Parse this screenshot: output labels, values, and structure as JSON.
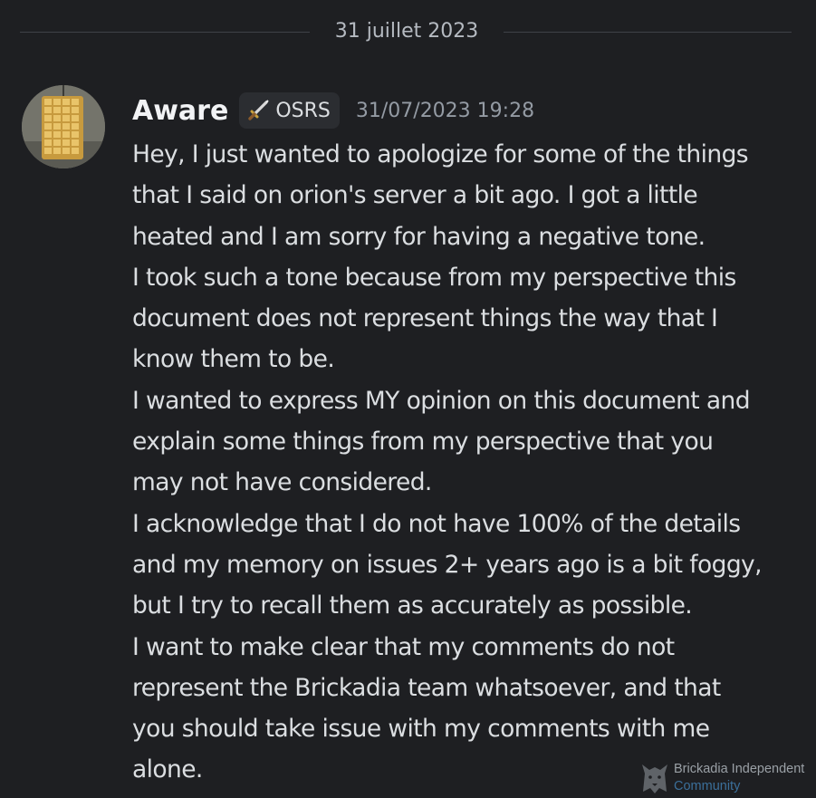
{
  "date_divider": {
    "label": "31 juillet 2023"
  },
  "message": {
    "author": "Aware",
    "tag": {
      "icon": "sword-icon",
      "label": "OSRS"
    },
    "timestamp": "31/07/2023 19:28",
    "lines": [
      "Hey, I just wanted to apologize for some of the things",
      "that I said on orion's server a bit ago. I got a little",
      "heated and I am sorry for having a negative tone.",
      "I took such a tone because from my perspective this",
      "document does not represent things the way that I",
      "know them to be.",
      "I wanted to express MY opinion on this document and",
      "explain some things from my perspective that you",
      "may not have considered.",
      "I acknowledge that I do not have 100% of the details",
      "and my memory on issues 2+ years ago is a bit foggy,",
      "but I try to recall them as accurately as possible.",
      "I want to make clear that my comments do not",
      "represent the Brickadia team whatsoever, and that",
      "you should take issue with my comments with me",
      "alone."
    ]
  },
  "watermark": {
    "line1": "Brickadia Independent",
    "line2": "Community"
  },
  "colors": {
    "background": "#1e1f22",
    "text": "#dbdee1",
    "username": "#f2f3f5",
    "muted": "#949ba4",
    "tag_bg": "#2b2d31"
  }
}
